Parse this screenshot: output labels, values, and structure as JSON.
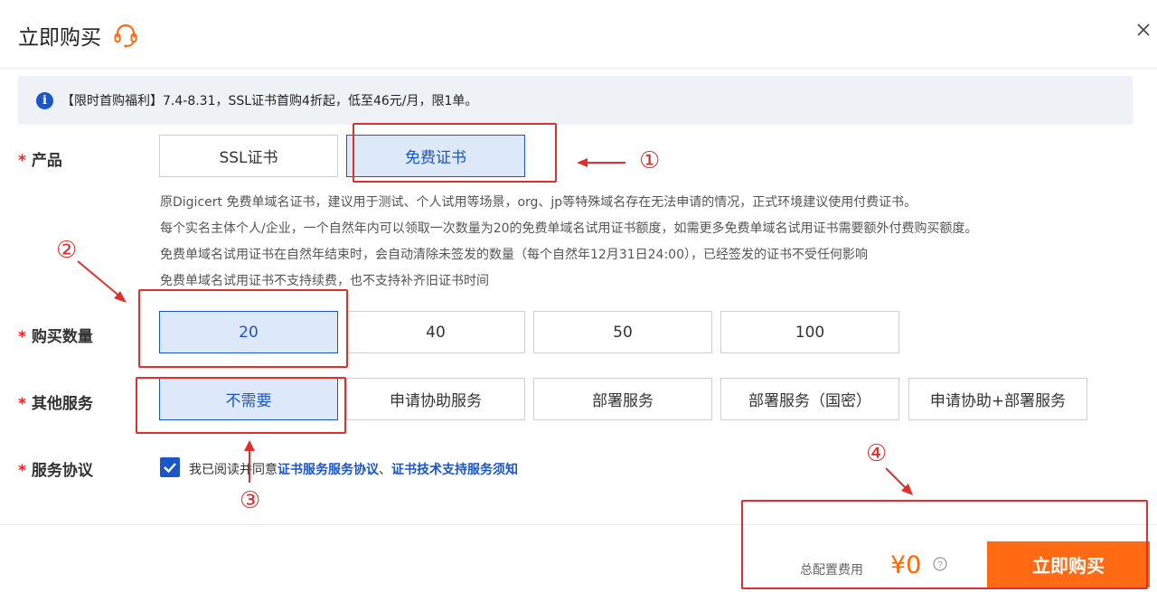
{
  "dialog": {
    "title": "立即购买",
    "close_icon": "close-icon",
    "service_icon": "customer-service-icon"
  },
  "notice": {
    "icon": "info-icon",
    "icon_glyph": "i",
    "text": "【限时首购福利】7.4-8.31，SSL证书首购4折起，低至46元/月，限1单。"
  },
  "product": {
    "label": "产品",
    "options": [
      "SSL证书",
      "免费证书"
    ],
    "selected": "免费证书",
    "descriptions": [
      "原Digicert 免费单域名证书，建议用于测试、个人试用等场景，org、jp等特殊域名存在无法申请的情况，正式环境建议使用付费证书。",
      "每个实名主体个人/企业，一个自然年内可以领取一次数量为20的免费单域名试用证书额度，如需更多免费单域名试用证书需要额外付费购买额度。",
      "免费单域名试用证书在自然年结束时，会自动清除未签发的数量（每个自然年12月31日24:00），已经签发的证书不受任何影响",
      "免费单域名试用证书不支持续费，也不支持补齐旧证书时间"
    ]
  },
  "quantity": {
    "label": "购买数量",
    "options": [
      "20",
      "40",
      "50",
      "100"
    ],
    "selected": "20"
  },
  "other_services": {
    "label": "其他服务",
    "options": [
      "不需要",
      "申请协助服务",
      "部署服务",
      "部署服务（国密）",
      "申请协助+部署服务"
    ],
    "selected": "不需要"
  },
  "agreement": {
    "label": "服务协议",
    "checked": true,
    "text_prefix": "我已阅读并同意",
    "link1": "证书服务服务协议",
    "separator": "、",
    "link2": "证书技术支持服务须知"
  },
  "footer": {
    "total_label": "总配置费用",
    "price": "¥0",
    "help_icon": "question-circle-icon",
    "buy_label": "立即购买"
  },
  "annotations": [
    "①",
    "②",
    "③",
    "④"
  ],
  "colors": {
    "accent": "#1a56c8",
    "selected_bg": "#dde8f8",
    "price": "#ff6600",
    "buy_button": "#ff6a13",
    "annotation_red": "#e0302b",
    "required_star": "#e22222"
  }
}
